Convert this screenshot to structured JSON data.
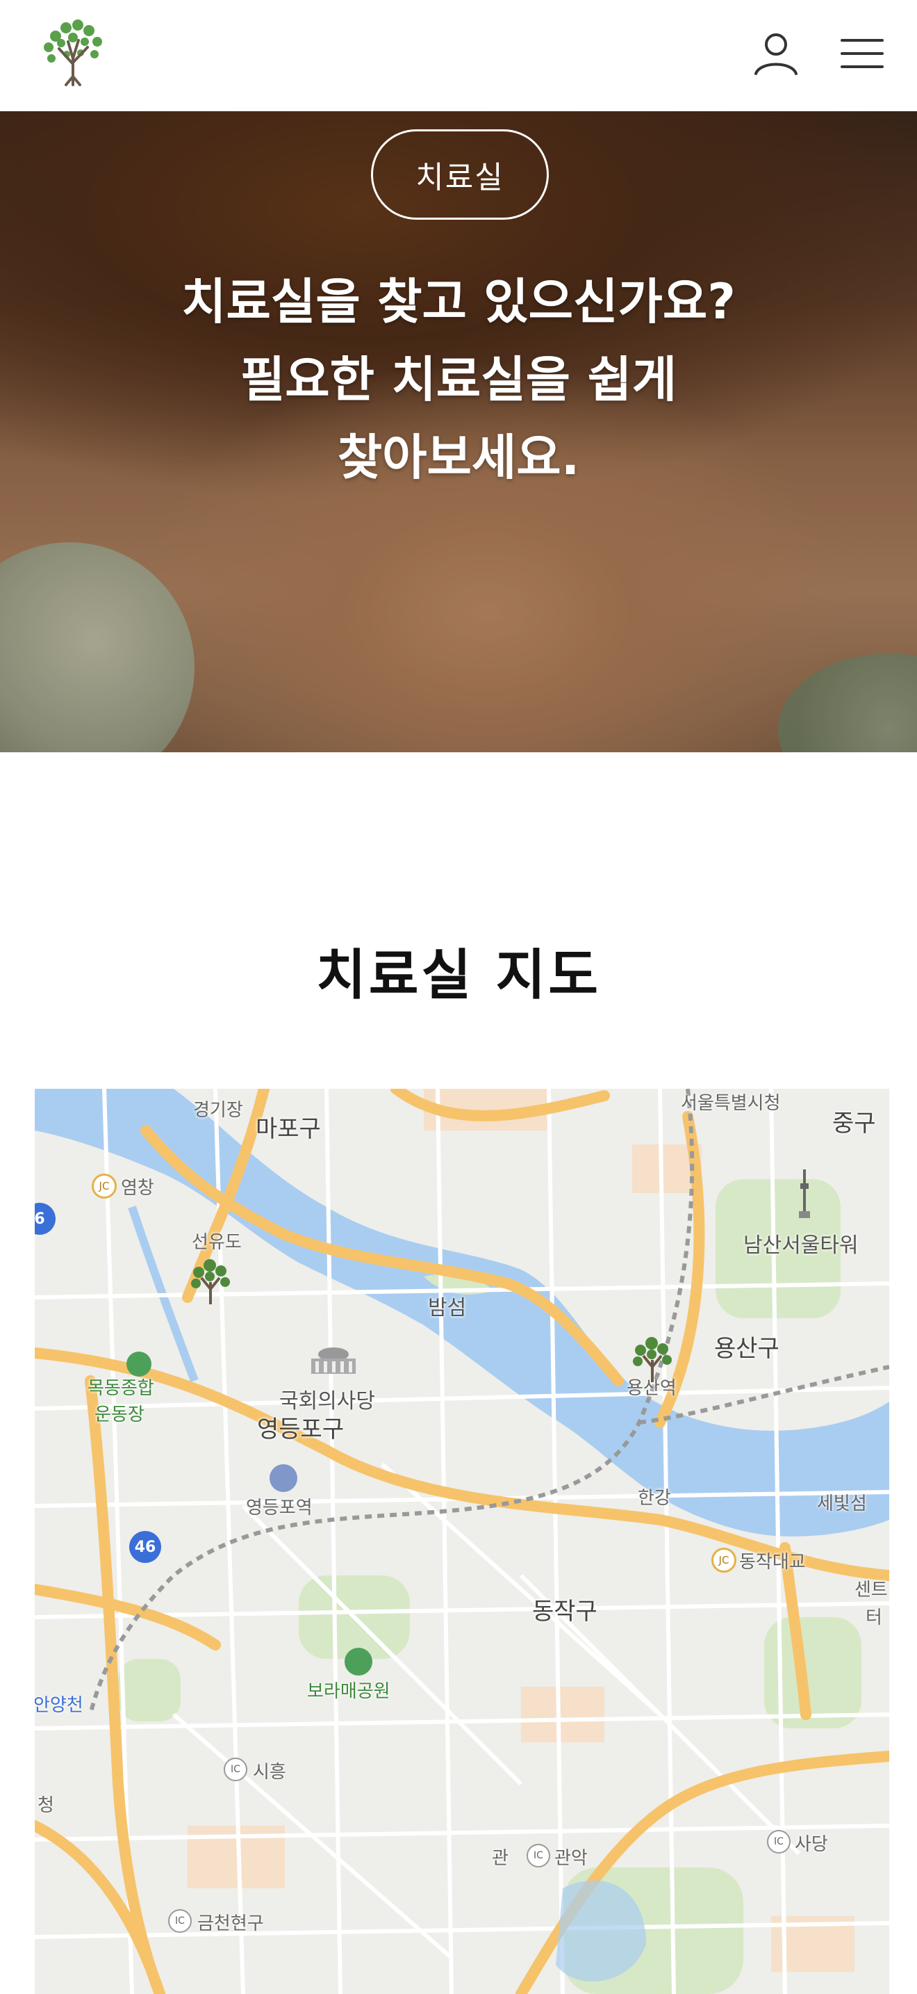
{
  "header": {
    "logo_icon": "tree-logo-icon",
    "user_icon": "user-icon",
    "menu_icon": "hamburger-menu-icon"
  },
  "hero": {
    "badge_label": "치료실",
    "heading_line1": "치료실을 찾고 있으신가요?",
    "heading_line2": "필요한 치료실을 쉽게",
    "heading_line3": "찾아보세요."
  },
  "map_section": {
    "title": "치료실 지도",
    "labels": {
      "mapo": "마포구",
      "stadium": "경기장",
      "yeomchang": "염창",
      "seonyudo": "선유도",
      "bamseom": "밤섬",
      "namsan": "남산서울타워",
      "yongsan": "용산구",
      "yongsan_station": "용산역",
      "mokdong": "목동종합",
      "mokdong2": "운동장",
      "assembly": "국회의사당",
      "yeongdeungpo_gu": "영등포구",
      "yeongdeungpo_station": "영등포역",
      "hangang": "한강",
      "sebit": "세빛섬",
      "dongjakdaegyo": "동작대교",
      "center": "센트",
      "ter": "터",
      "seoul_city": "서울특별시청",
      "junggu": "중구",
      "dongjak": "동작구",
      "boramae": "보라매공원",
      "siheung": "시흥",
      "anyangcheon": "안양천",
      "cheong": "청",
      "gwanak": "관악",
      "gwan": "관",
      "sadang": "사당",
      "geumcheon": "금천현구",
      "route46": "46",
      "route6": "6",
      "jc": "JC",
      "ic": "IC"
    }
  },
  "colors": {
    "river": "#a9cdf0",
    "major_road": "#f6c36b",
    "road": "#ffffff",
    "land": "#eeeeea",
    "park": "#d7e8c6",
    "accent_green": "#4f8a3c"
  }
}
